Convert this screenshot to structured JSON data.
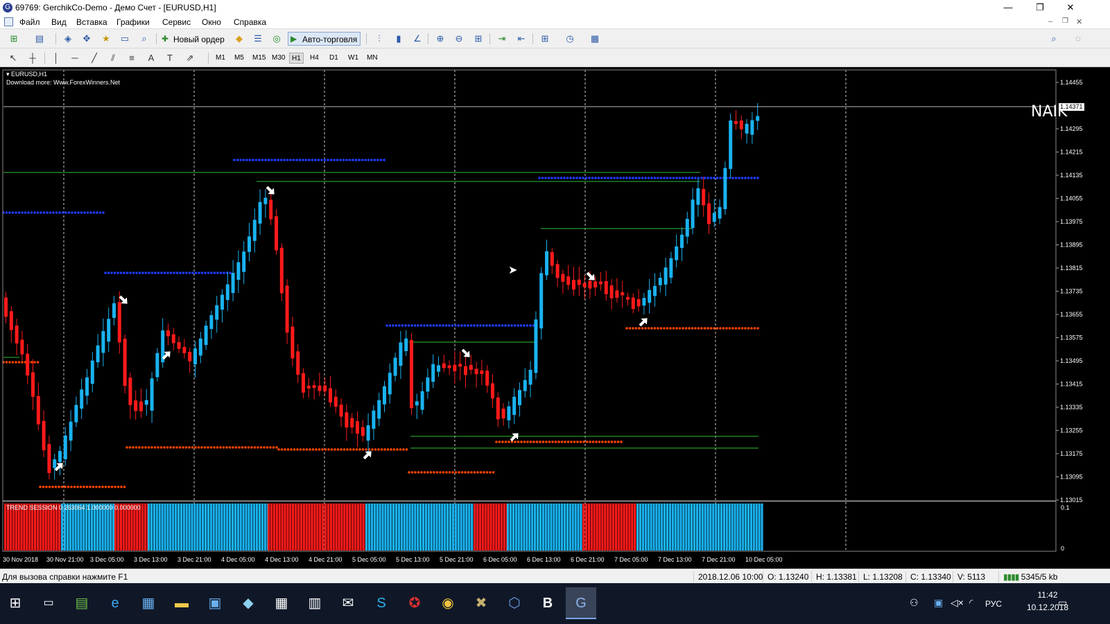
{
  "window": {
    "title": "69769: GerchikCo-Demo - Демо Счет - [EURUSD,H1]",
    "minimize": "—",
    "restore": "❐",
    "close": "✕"
  },
  "menu": [
    "Файл",
    "Вид",
    "Вставка",
    "Графики",
    "Сервис",
    "Окно",
    "Справка"
  ],
  "toolbar": {
    "new_order": "Новый ордер",
    "auto_trading": "Авто-торговля",
    "timeframes": [
      "M1",
      "M5",
      "M15",
      "M30",
      "H1",
      "H4",
      "D1",
      "W1",
      "MN"
    ],
    "active_timeframe": "H1"
  },
  "chart": {
    "symbol_label": "EURUSD,H1",
    "download_note": "Download more: Www.ForexWinners.Net",
    "watermark": "NAIK",
    "current_price": "1.14371",
    "price_ticks": [
      "1.14455",
      "1.14295",
      "1.14215",
      "1.14135",
      "1.14055",
      "1.13975",
      "1.13895",
      "1.13815",
      "1.13735",
      "1.13655",
      "1.13575",
      "1.13495",
      "1.13415",
      "1.13335",
      "1.13255",
      "1.13175",
      "1.13095",
      "1.13015"
    ],
    "time_ticks": [
      "30 Nov 2018",
      "30 Nov 21:00",
      "3 Dec 05:00",
      "3 Dec 13:00",
      "3 Dec 21:00",
      "4 Dec 05:00",
      "4 Dec 13:00",
      "4 Dec 21:00",
      "5 Dec 05:00",
      "5 Dec 13:00",
      "5 Dec 21:00",
      "6 Dec 05:00",
      "6 Dec 13:00",
      "6 Dec 21:00",
      "7 Dec 05:00",
      "7 Dec 13:00",
      "7 Dec 21:00",
      "10 Dec 05:00"
    ],
    "colors": {
      "bull": "#1ab2f0",
      "bear": "#ff1a1a",
      "background": "#000000",
      "support_dots": "#ff4500",
      "resistance_dots": "#1f3cff",
      "level_lines": "#2fbf2f"
    }
  },
  "indicator": {
    "label": "TREND SESSION 0.263064 1.000000 0.000000",
    "scale_top": "0.1",
    "scale_bottom": "0"
  },
  "status": {
    "help": "Для вызова справки нажмите F1",
    "datetime": "2018.12.06 10:00",
    "open": "O: 1.13240",
    "high": "H: 1.13381",
    "low": "L: 1.13208",
    "close": "C: 1.13340",
    "volume": "V: 5113",
    "traffic": "5345/5 kb"
  },
  "taskbar": {
    "lang": "РУС",
    "time": "11:42",
    "date": "10.12.2018"
  }
}
